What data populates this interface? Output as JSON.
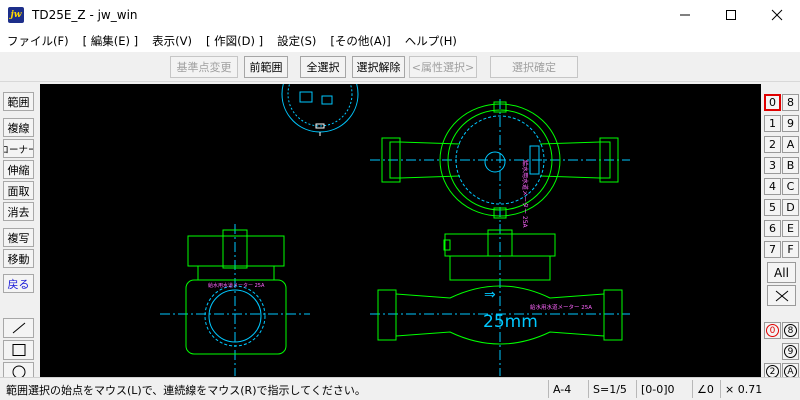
{
  "window": {
    "app_icon_text": "jw",
    "title": "TD25E_Z - jw_win",
    "minimize_glyph": "—",
    "maximize_glyph": "☐",
    "close_glyph": "✕"
  },
  "menu": [
    "ファイル(F)",
    "[ 編集(E) ]",
    "表示(V)",
    "[ 作図(D) ]",
    "設定(S)",
    "[その他(A)]",
    "ヘルプ(H)"
  ],
  "toolbar": {
    "base_change": "基準点変更",
    "prev_range": "前範囲",
    "select_all": "全選択",
    "deselect": "選択解除",
    "attr_select": "<属性選択>",
    "confirm_select": "選択確定"
  },
  "left_tools": {
    "range": "範囲",
    "polyline": "複線",
    "corner": "コーナー",
    "stretch": "伸縮",
    "area_cut": "面取",
    "erase": "消去",
    "copy": "複写",
    "move": "移動",
    "back": "戻る",
    "line_glyph": "／",
    "rect_glyph": "□",
    "circle_glyph": "○"
  },
  "layers": {
    "left": [
      "0",
      "1",
      "2",
      "3",
      "4",
      "5",
      "6",
      "7"
    ],
    "right": [
      "8",
      "9",
      "A",
      "B",
      "C",
      "D",
      "E",
      "F"
    ],
    "all": "All",
    "cross": "✕",
    "groups_left": [
      "0",
      "",
      "2"
    ],
    "groups_right": [
      "8",
      "9",
      "A"
    ]
  },
  "drawing": {
    "meter_label": "給水用水道メーター 25A",
    "size_label": "25mm",
    "arrow_label": "⇒"
  },
  "status": {
    "message": "範囲選択の始点をマウス(L)で、連続線をマウス(R)で指示してください。",
    "paper": "A-4",
    "scale": "S=1/5",
    "layer": "[0-0]0",
    "angle": "∠0",
    "factor": "× 0.71"
  }
}
